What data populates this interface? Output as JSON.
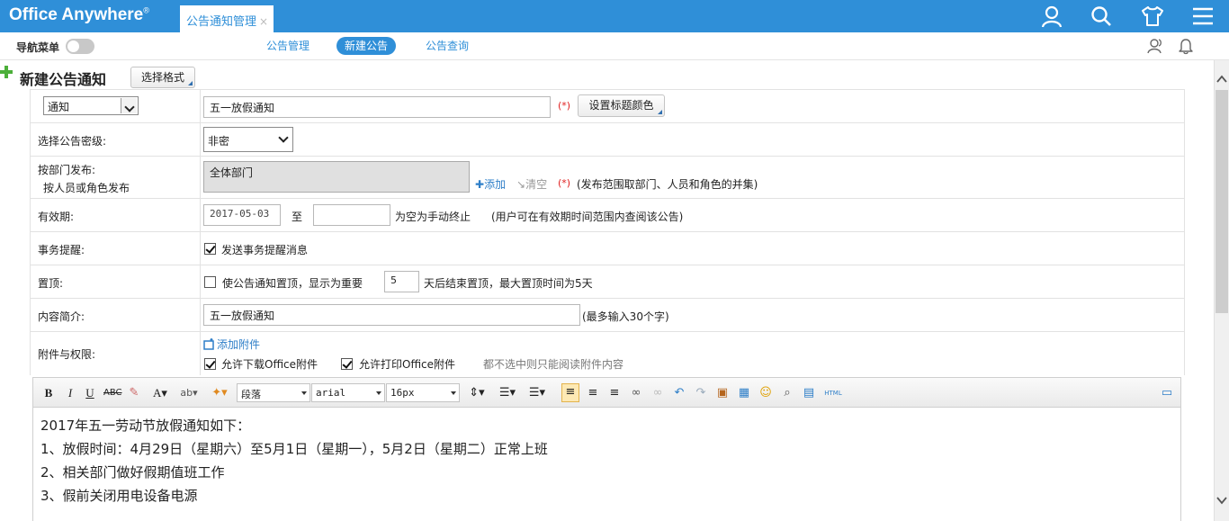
{
  "app": {
    "logo": "Office Anywhere",
    "logo_mark": "®"
  },
  "header": {
    "tab_label": "公告通知管理",
    "tab_close": "×",
    "icons": [
      "user-icon",
      "search-icon",
      "shirt-icon",
      "menu-icon"
    ]
  },
  "subnav": {
    "nav_menu_label": "导航菜单",
    "tabs": [
      {
        "label": "公告管理",
        "active": false
      },
      {
        "label": "新建公告",
        "active": true
      },
      {
        "label": "公告查询",
        "active": false
      }
    ],
    "icons": [
      "people-icon",
      "bell-icon"
    ]
  },
  "page": {
    "title": "新建公告通知",
    "format_button": "选择格式"
  },
  "form": {
    "type_select": "通知",
    "title_value": "五一放假通知",
    "required_mark": "(*)",
    "title_color_button": "设置标题颜色",
    "secrecy_label": "选择公告密级:",
    "secrecy_value": "非密",
    "dept_label": "按部门发布:",
    "dept_alt_link": "按人员或角色发布",
    "dept_value": "全体部门",
    "add_link": "添加",
    "clear_link": "清空",
    "dept_note": "(发布范围取部门、人员和角色的并集)",
    "valid_label": "有效期:",
    "valid_from": "2017-05-03",
    "valid_to_word": "至",
    "valid_to": "",
    "valid_empty_note": "为空为手动终止",
    "valid_note": "(用户可在有效期时间范围内查阅该公告)",
    "remind_label": "事务提醒:",
    "remind_text": "发送事务提醒消息",
    "remind_checked": true,
    "top_label": "置顶:",
    "top_text": "使公告通知置顶，显示为重要",
    "top_checked": false,
    "top_days": "5",
    "top_days_note": "天后结束置顶，最大置顶时间为5天",
    "summary_label": "内容简介:",
    "summary_value": "五一放假通知",
    "summary_note": "(最多输入30个字)",
    "attach_label": "附件与权限:",
    "add_attach": "添加附件",
    "allow_download": "允许下载Office附件",
    "allow_print": "允许打印Office附件",
    "attach_note": "都不选中则只能阅读附件内容"
  },
  "editor": {
    "paragraph": "段落",
    "font": "arial",
    "size": "16px",
    "html_label": "HTML",
    "lines": [
      "2017年五一劳动节放假通知如下：",
      "1、放假时间：4月29日（星期六）至5月1日（星期一），5月2日（星期二）正常上班",
      "2、相关部门做好假期值班工作",
      "3、假前关闭用电设备电源"
    ]
  },
  "colors": {
    "brand": "#2f8fd8",
    "required": "#e02020",
    "link": "#2f7fc8"
  }
}
